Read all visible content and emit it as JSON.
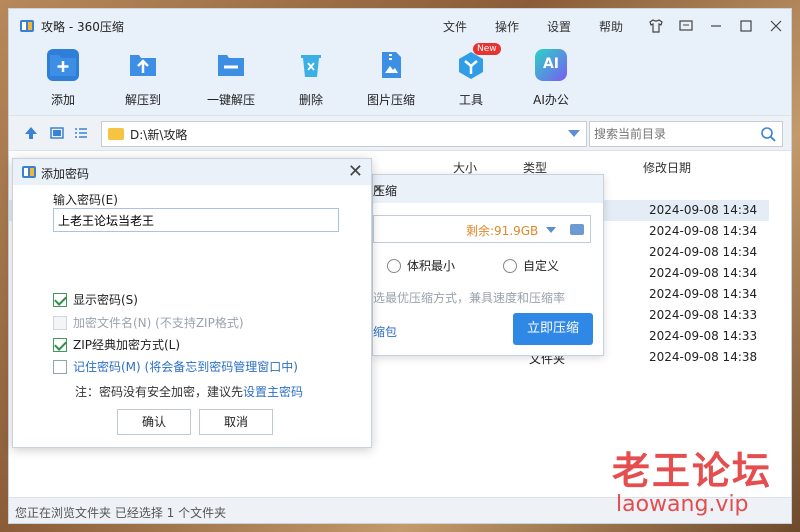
{
  "window": {
    "title": "攻略 - 360压缩",
    "menu": [
      "文件",
      "操作",
      "设置",
      "帮助"
    ]
  },
  "toolbar": {
    "items": [
      {
        "label": "添加",
        "icon": "add-icon"
      },
      {
        "label": "解压到",
        "icon": "extract-to-icon"
      },
      {
        "label": "一键解压",
        "icon": "one-click-extract-icon"
      },
      {
        "label": "删除",
        "icon": "delete-icon"
      },
      {
        "label": "图片压缩",
        "icon": "image-compress-icon"
      },
      {
        "label": "工具",
        "icon": "tools-icon",
        "badge": "New"
      },
      {
        "label": "AI办公",
        "icon": "ai-office-icon",
        "glyph": "AI"
      }
    ]
  },
  "address": {
    "path": "D:\\新\\攻略",
    "search_placeholder": "搜索当前目录"
  },
  "filelist": {
    "headers": {
      "size": "大小",
      "type": "类型",
      "modified": "修改日期"
    },
    "rows": [
      {
        "type": "",
        "date": "2024-09-08 14:34",
        "selected": true
      },
      {
        "type": "",
        "date": "2024-09-08 14:34"
      },
      {
        "type": "",
        "date": "2024-09-08 14:34"
      },
      {
        "type": "",
        "date": "2024-09-08 14:34"
      },
      {
        "type": "",
        "date": "2024-09-08 14:34"
      },
      {
        "type": "",
        "date": "2024-09-08 14:33"
      },
      {
        "type": "",
        "date": "2024-09-08 14:33"
      },
      {
        "type": "文件夹",
        "date": "2024-09-08 14:38"
      }
    ]
  },
  "status": {
    "text": "您正在浏览文件夹 已经选择 1 个文件夹"
  },
  "compress_dialog": {
    "title_fragment": "压缩",
    "free_space": "剩余:91.9GB",
    "options": [
      "体积最小",
      "自定义"
    ],
    "description_fragment": "选最优压缩方式，兼具速度和压缩率",
    "pack_link_fragment": "缩包",
    "start_button": "立即压缩"
  },
  "password_dialog": {
    "title": "添加密码",
    "label": "输入密码(E)",
    "value": "上老王论坛当老王",
    "show_password": "显示密码(S)",
    "encrypt_filenames": "加密文件名(N) (不支持ZIP格式)",
    "zip_classic": "ZIP经典加密方式(L)",
    "remember": "记住密码(M) (将会备忘到密码管理窗口中)",
    "note_prefix": "注：密码没有安全加密，建议先",
    "note_link": "设置主密码",
    "ok": "确认",
    "cancel": "取消"
  },
  "watermark": {
    "line1": "老王论坛",
    "line2": "laowang.vip"
  }
}
